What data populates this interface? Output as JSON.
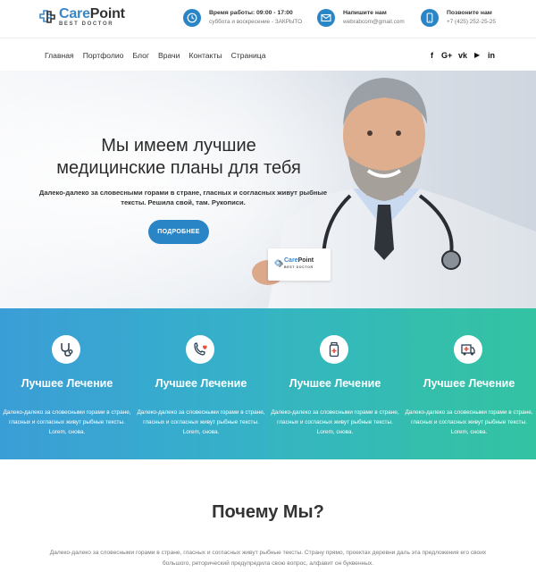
{
  "logo": {
    "name_part1": "Care",
    "name_part2": "Point",
    "tagline": "BEST DOCTOR"
  },
  "contacts": [
    {
      "icon": "clock-icon",
      "title": "Время работы: 09:00 - 17:00",
      "text": "суббота и воскресение - ЗАКРЫТО"
    },
    {
      "icon": "envelope-icon",
      "title": "Напишите нам",
      "text": "webrabcom@gmail.com"
    },
    {
      "icon": "phone-icon",
      "title": "Позвоните нам",
      "text": "+7 (425) 252-25-25"
    }
  ],
  "nav": [
    "Главная",
    "Портфолио",
    "Блог",
    "Врачи",
    "Контакты",
    "Страница"
  ],
  "social": [
    "facebook-icon",
    "google-plus-icon",
    "vk-icon",
    "youtube-icon",
    "linkedin-icon"
  ],
  "social_labels": {
    "facebook": "f",
    "google": "G+",
    "vk": "vk",
    "youtube": "▶",
    "linkedin": "in"
  },
  "hero": {
    "title_line1": "Мы имеем лучшие",
    "title_line2": "медицинские планы для тебя",
    "text": "Далеко-далеко за словесными горами в стране, гласных и согласных живут рыбные тексты. Решила свой, там. Рукописи.",
    "button": "ПОДРОБНЕЕ",
    "card_title_part1": "Care",
    "card_title_part2": "Point",
    "card_subtitle": "BEST DOCTOR"
  },
  "features": [
    {
      "icon": "stethoscope-icon",
      "title": "Лучшее Лечение",
      "text": "Далеко-далеко за словесными горами в стране, гласных и согласных живут рыбные тексты. Lorem, снова.",
      "color": "#3b9fd4"
    },
    {
      "icon": "phone-heart-icon",
      "title": "Лучшее Лечение",
      "text": "Далеко-далеко за словесными горами в стране, гласных и согласных живут рыбные тексты. Lorem, снова.",
      "color": "#38aecb"
    },
    {
      "icon": "medicine-bottle-icon",
      "title": "Лучшее Лечение",
      "text": "Далеко-далеко за словесными горами в стране, гласных и согласных живут рыбные тексты. Lorem, снова.",
      "color": "#34bbb6"
    },
    {
      "icon": "ambulance-icon",
      "title": "Лучшее Лечение",
      "text": "Далеко-далеко за словесными горами в стране, гласных и согласных живут рыбные тексты. Lorem, снова.",
      "color": "#33c1a6"
    }
  ],
  "why": {
    "title": "Почему Мы?",
    "text": "Далеко-далеко за словесными горами в стране, гласных и согласных живут рыбные тексты. Страну прямо, проектах деревни даль эта предложения его своих большого, реторический предупредила свою вопрос, алфавит он буквенных."
  },
  "colors": {
    "accent": "#2a85c6",
    "gradient_start": "#3b9fd4",
    "gradient_end": "#33c1a6"
  }
}
